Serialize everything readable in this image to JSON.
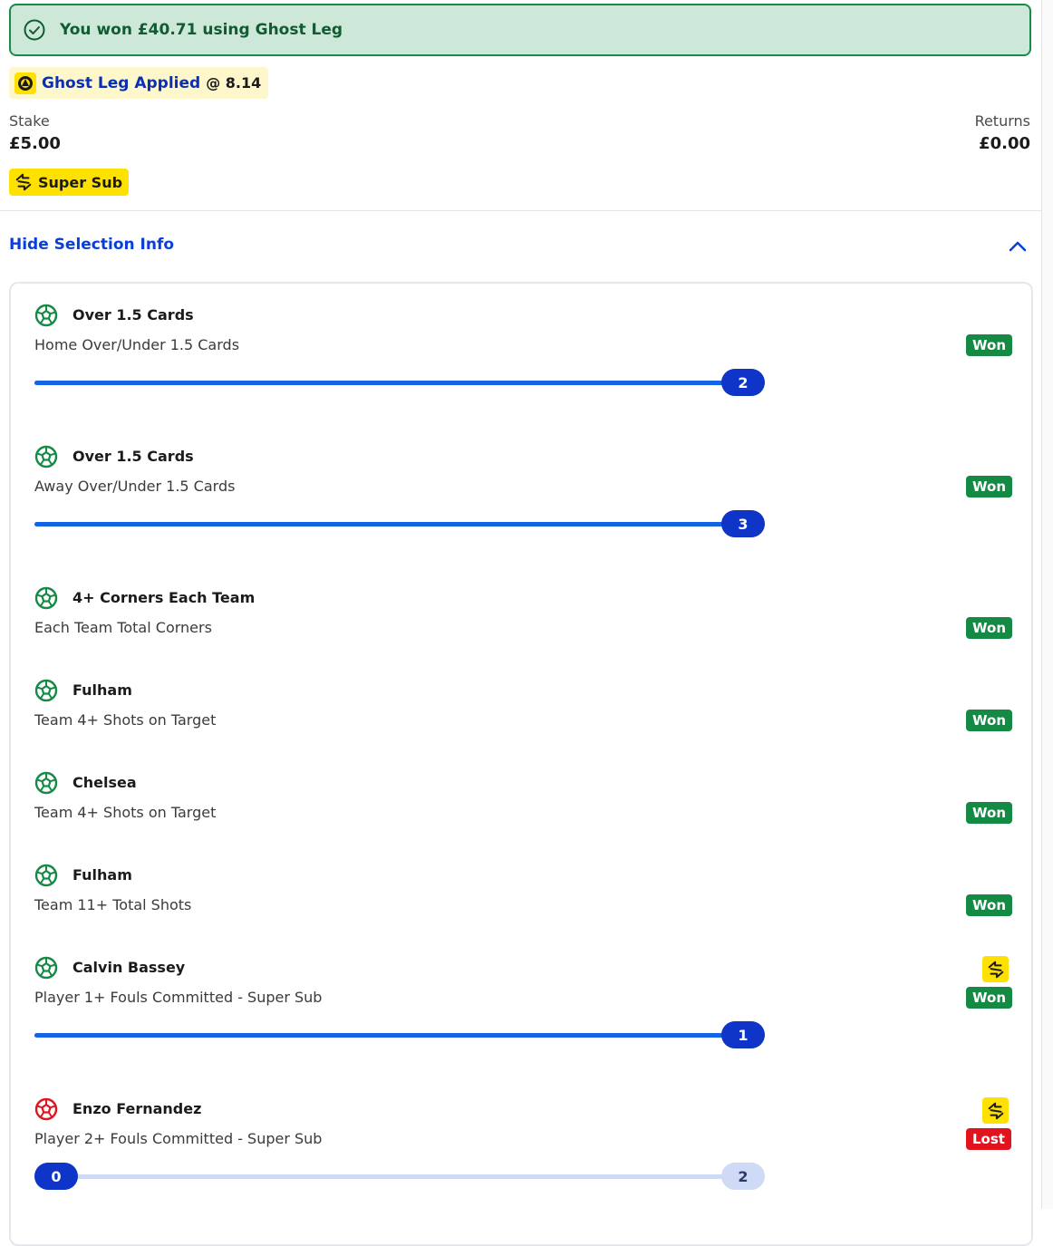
{
  "banner": {
    "text": "You won £40.71 using Ghost Leg"
  },
  "ghost_leg": {
    "label": "Ghost Leg Applied",
    "odds": "@ 8.14"
  },
  "stake": {
    "label": "Stake",
    "value": "£5.00"
  },
  "returns": {
    "label": "Returns",
    "value": "£0.00"
  },
  "super_sub": {
    "label": "Super Sub"
  },
  "selection_toggle": {
    "label": "Hide Selection Info"
  },
  "colors": {
    "won": "#148a45",
    "lost": "#e1141e",
    "accent": "#0a3fd6",
    "banner_bg": "#cde8d9",
    "super_sub": "#ffe100"
  },
  "selections": [
    {
      "title": "Over 1.5 Cards",
      "market": "Home Over/Under 1.5 Cards",
      "status": "Won",
      "progress": {
        "current": "2",
        "fraction": 1.0
      }
    },
    {
      "title": "Over 1.5 Cards",
      "market": "Away Over/Under 1.5 Cards",
      "status": "Won",
      "progress": {
        "current": "3",
        "fraction": 1.0
      }
    },
    {
      "title": "4+ Corners Each Team",
      "market": "Each Team Total Corners",
      "status": "Won"
    },
    {
      "title": "Fulham",
      "market": "Team 4+ Shots on Target",
      "status": "Won"
    },
    {
      "title": "Chelsea",
      "market": "Team 4+ Shots on Target",
      "status": "Won"
    },
    {
      "title": "Fulham",
      "market": "Team 11+ Total Shots",
      "status": "Won"
    },
    {
      "title": "Calvin Bassey",
      "market": "Player 1+ Fouls Committed - Super Sub",
      "status": "Won",
      "super_sub_icon": true,
      "progress": {
        "current": "1",
        "fraction": 1.0
      }
    },
    {
      "title": "Enzo Fernandez",
      "market": "Player 2+ Fouls Committed - Super Sub",
      "status": "Lost",
      "super_sub_icon": true,
      "progress": {
        "current": "0",
        "target": "2",
        "fraction": 0.0
      }
    }
  ]
}
